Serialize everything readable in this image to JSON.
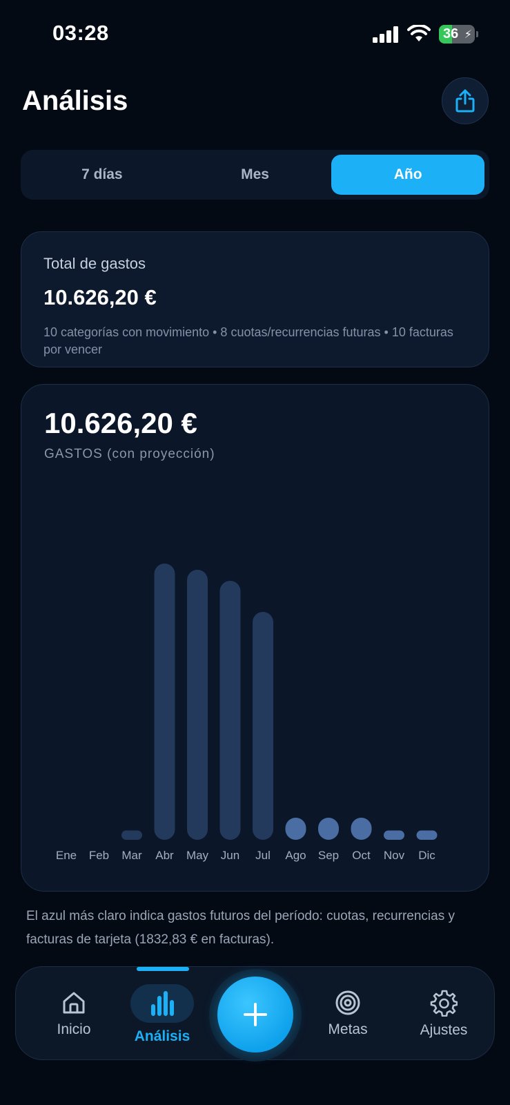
{
  "status_bar": {
    "time": "03:28",
    "battery": "36",
    "battery_level": 0.36
  },
  "header": {
    "title": "Análisis"
  },
  "segments": [
    {
      "label": "7 días",
      "active": false
    },
    {
      "label": "Mes",
      "active": false
    },
    {
      "label": "Año",
      "active": true
    }
  ],
  "summary": {
    "label": "Total de gastos",
    "amount": "10.626,20 €",
    "detail": "10 categorías con movimiento • 8 cuotas/recurrencias futuras • 10 facturas por vencer"
  },
  "chart_card": {
    "total": "10.626,20 €",
    "subtitle": "GASTOS (con proyección)"
  },
  "chart_data": {
    "type": "bar",
    "categories": [
      "Ene",
      "Feb",
      "Mar",
      "Abr",
      "May",
      "Jun",
      "Jul",
      "Ago",
      "Sep",
      "Oct",
      "Nov",
      "Dic"
    ],
    "values": [
      0,
      0,
      60,
      2000,
      1955,
      1875,
      1650,
      160,
      160,
      160,
      60,
      60
    ],
    "ylim": [
      0,
      2000
    ],
    "grid": false,
    "colors": {
      "bar": "#233a5d",
      "projected": "#4a6ea3"
    },
    "projected_from_index": 7
  },
  "footnote": "El azul más claro indica gastos futuros del período: cuotas, recurrencias y facturas de tarjeta (1832,83 € en facturas).",
  "nav": {
    "items": [
      {
        "label": "Inicio",
        "icon": "home-icon"
      },
      {
        "label": "Análisis",
        "icon": "bar-chart-icon"
      },
      {
        "label": "Metas",
        "icon": "target-icon"
      },
      {
        "label": "Ajustes",
        "icon": "gear-icon"
      }
    ],
    "add_icon": "plus-icon"
  },
  "colors": {
    "accent": "#1cb0f6",
    "background": "#040a14",
    "card": "#0d1a2e"
  }
}
